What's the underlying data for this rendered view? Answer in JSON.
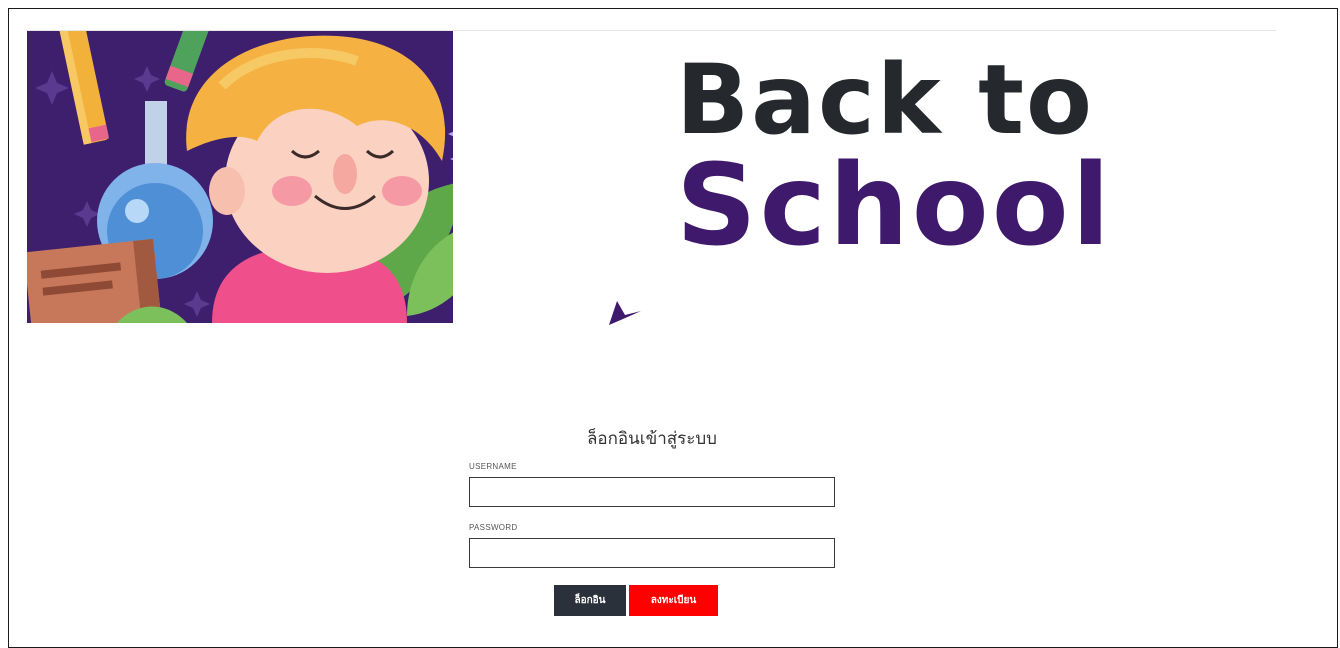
{
  "banner": {
    "title_line1": "Back to",
    "title_line2": "School"
  },
  "login": {
    "heading": "ล็อกอินเข้าสู่ระบบ",
    "username_label": "USERNAME",
    "username_value": "",
    "password_label": "PASSWORD",
    "password_value": "",
    "login_button": "ล็อกอิน",
    "register_button": "ลงทะเบียน"
  },
  "colors": {
    "login_button": "#2a313a",
    "register_button": "#ff0000",
    "title_dark": "#25282d",
    "title_purple": "#3f1a6c"
  }
}
